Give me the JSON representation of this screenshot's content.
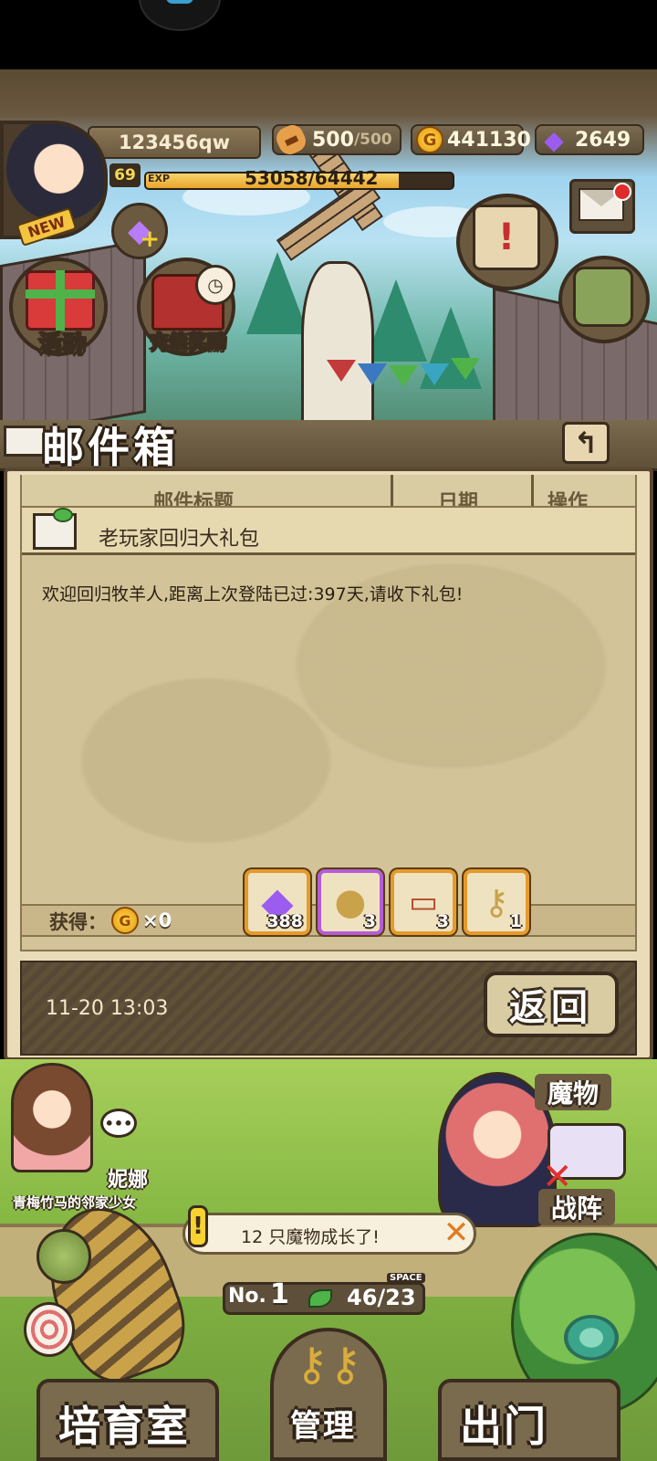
{
  "header": {
    "username": "123456qw",
    "new_tag": "NEW",
    "level": "69",
    "exp_label": "EXP",
    "exp_text": "53058/64442",
    "exp_progress": 0.8234,
    "stamina_current": "500",
    "stamina_max": "/500",
    "gold": "441130",
    "gems": "2649"
  },
  "buttons": {
    "event_label": "活动",
    "recharge_label": "充值奖励"
  },
  "mailbox": {
    "title": "邮件箱",
    "columns": [
      "邮件标题",
      "日期",
      "操作"
    ],
    "mail": {
      "subject": "老玩家回归大礼包",
      "body": "欢迎回归牧羊人,距离上次登陆已过:397天,请收下礼包!",
      "obtain_label": "获得：",
      "gold_count": "×0",
      "date": "11-20 13:03",
      "items": [
        {
          "icon": "gem-icon",
          "count": "388"
        },
        {
          "icon": "sack-icon",
          "count": "3"
        },
        {
          "icon": "ticket-icon",
          "count": "3"
        },
        {
          "icon": "key-icon",
          "count": "1"
        }
      ]
    },
    "return_label": "返回"
  },
  "farm": {
    "npc_name": "妮娜",
    "npc_desc": "青梅竹马的邻家少女",
    "npc_bubble": "•••",
    "notice": "12 只魔物成长了!",
    "monster_label": "魔物",
    "formation_label": "战阵",
    "farm_no_label": "No.",
    "farm_no": "1",
    "slot_count": "46/23",
    "space_tag": "SPACE"
  },
  "nav": {
    "nursery": "培育室",
    "manage": "管理",
    "exit": "出门"
  },
  "colors": {
    "frame": "#3a2c1e",
    "panel": "#d2c498",
    "accent_orange": "#e49a2c",
    "gem_purple": "#9c5cf0",
    "notif_red": "#e02b2b"
  }
}
